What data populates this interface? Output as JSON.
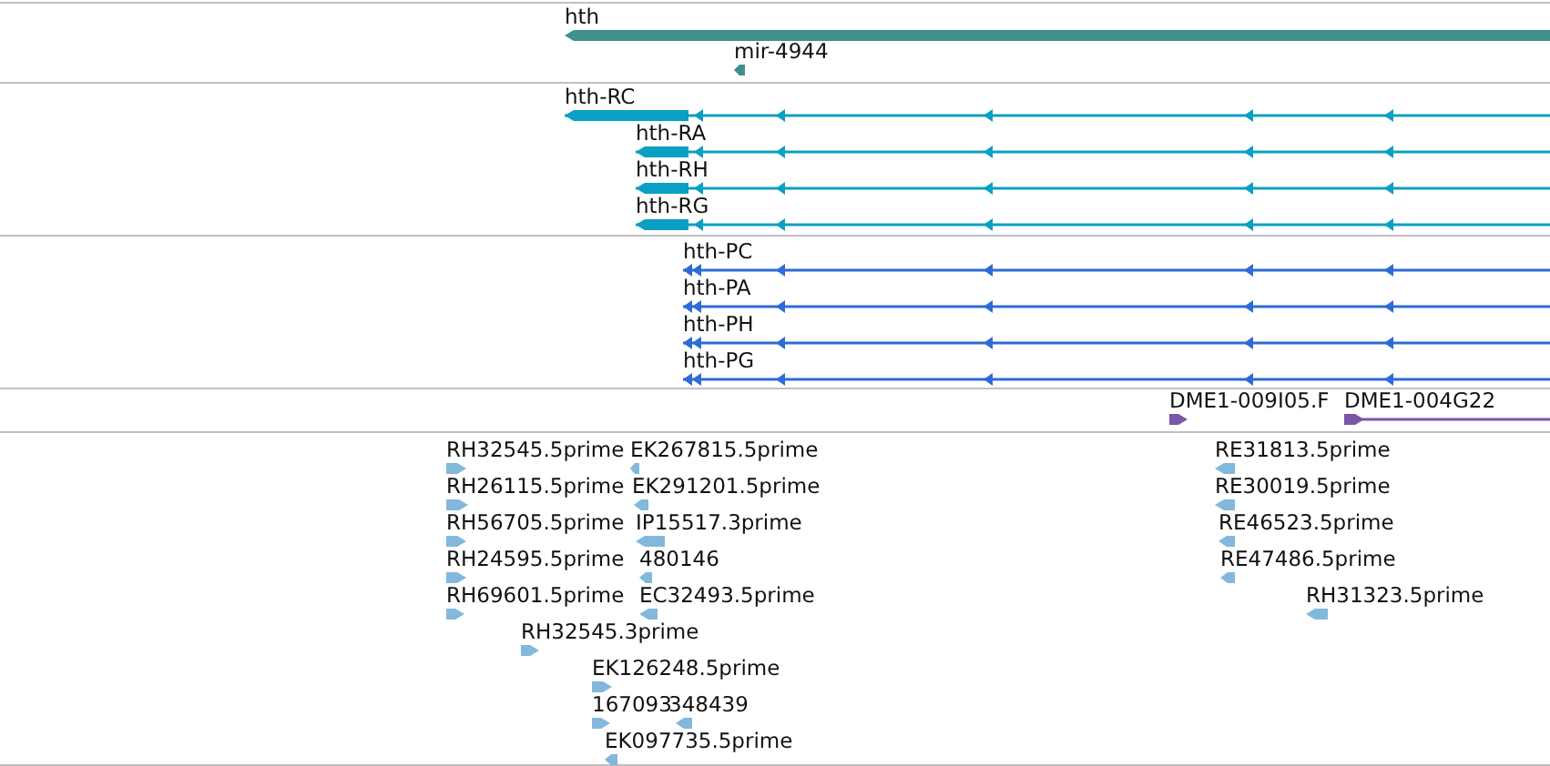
{
  "tracks": [
    {
      "kind": "gene",
      "features": [
        {
          "label": "hth",
          "reverse": true
        },
        {
          "label": "mir-4944",
          "reverse": true
        }
      ]
    },
    {
      "kind": "transcript",
      "features": [
        {
          "label": "hth-RC",
          "reverse": true
        },
        {
          "label": "hth-RA",
          "reverse": true
        },
        {
          "label": "hth-RH",
          "reverse": true
        },
        {
          "label": "hth-RG",
          "reverse": true
        }
      ]
    },
    {
      "kind": "protein",
      "features": [
        {
          "label": "hth-PC",
          "reverse": true
        },
        {
          "label": "hth-PA",
          "reverse": true
        },
        {
          "label": "hth-PH",
          "reverse": true
        },
        {
          "label": "hth-PG",
          "reverse": true
        }
      ]
    },
    {
      "kind": "clone",
      "features": [
        {
          "label": "DME1-009I05.F",
          "reverse": false
        },
        {
          "label": "DME1-004G22",
          "reverse": false
        }
      ]
    },
    {
      "kind": "est",
      "features": [
        {
          "label": "RH32545.5prime",
          "reverse": false
        },
        {
          "label": "EK267815.5prime",
          "reverse": true
        },
        {
          "label": "RH26115.5prime",
          "reverse": false
        },
        {
          "label": "EK291201.5prime",
          "reverse": true
        },
        {
          "label": "RH56705.5prime",
          "reverse": false
        },
        {
          "label": "IP15517.3prime",
          "reverse": true
        },
        {
          "label": "RH24595.5prime",
          "reverse": false
        },
        {
          "label": "480146",
          "reverse": true
        },
        {
          "label": "RH69601.5prime",
          "reverse": false
        },
        {
          "label": "EC32493.5prime",
          "reverse": true
        },
        {
          "label": "RH32545.3prime",
          "reverse": false
        },
        {
          "label": "EK126248.5prime",
          "reverse": false
        },
        {
          "label": "167093",
          "reverse": false
        },
        {
          "label": "348439",
          "reverse": true
        },
        {
          "label": "EK097735.5prime",
          "reverse": true
        },
        {
          "label": "RE31813.5prime",
          "reverse": true
        },
        {
          "label": "RE30019.5prime",
          "reverse": true
        },
        {
          "label": "RE46523.5prime",
          "reverse": true
        },
        {
          "label": "RE47486.5prime",
          "reverse": true
        },
        {
          "label": "RH31323.5prime",
          "reverse": true
        }
      ]
    }
  ]
}
